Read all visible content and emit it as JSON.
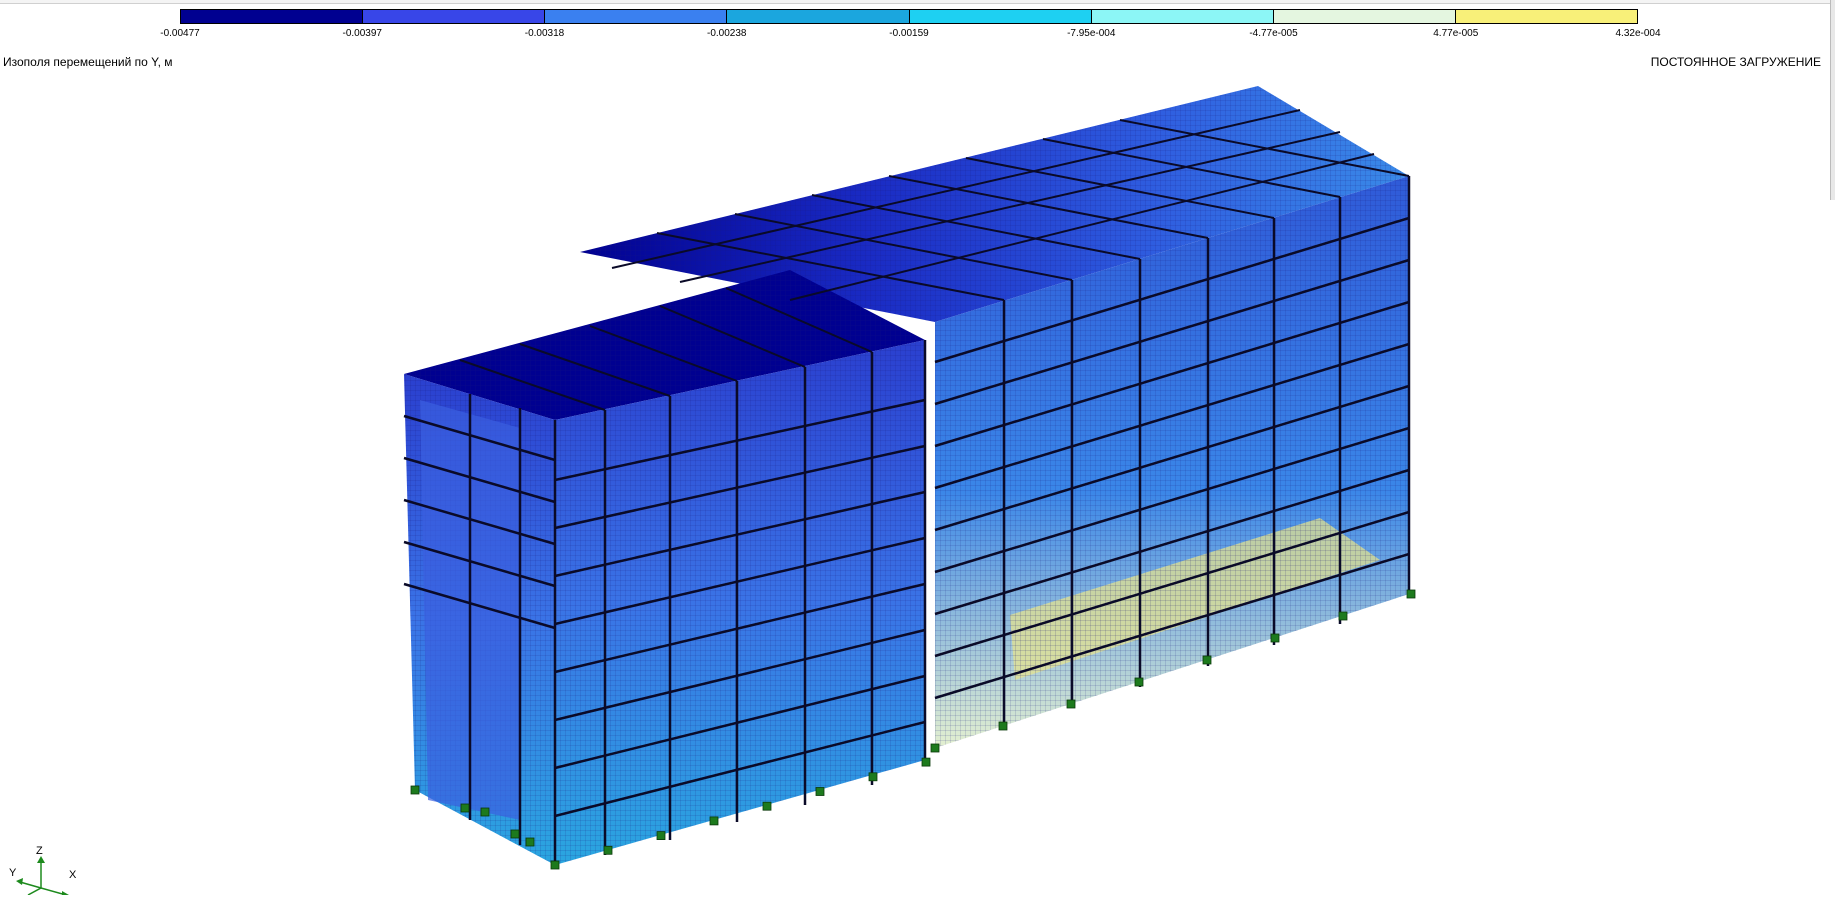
{
  "scale": {
    "colors": [
      "#000090",
      "#3846e8",
      "#3a80f0",
      "#1ba6de",
      "#1ed0f2",
      "#8cf6f6",
      "#e4f6e0",
      "#f8f079"
    ],
    "labels": [
      "-0.00477",
      "-0.00397",
      "-0.00318",
      "-0.00238",
      "-0.00159",
      "-7.95e-004",
      "-4.77e-005",
      "4.77e-005",
      "4.32e-004"
    ]
  },
  "title_left": "Изополя перемещений по Y, м",
  "title_right": "ПОСТОЯННОЕ ЗАГРУЖЕНИЕ",
  "axes": {
    "z_label": "Z",
    "y_label": "Y",
    "x_label": "X"
  },
  "model": {
    "mesh_color": "#1a1a7a",
    "support_color": "#1d7a1d",
    "beam_color": "#0a0a28"
  }
}
